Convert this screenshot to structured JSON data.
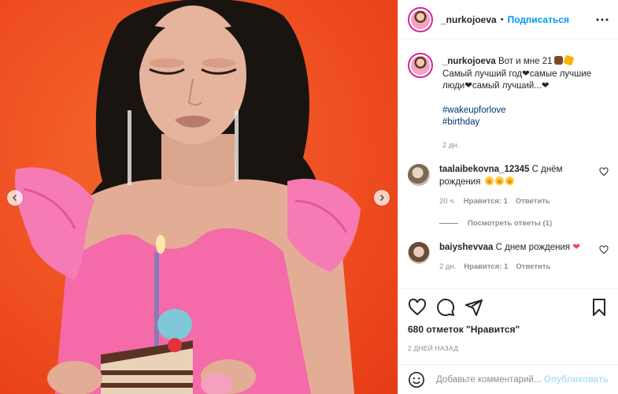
{
  "post": {
    "author": "_nurkojoeva",
    "dot": "•",
    "follow_label": "Подписаться",
    "caption": {
      "username": "_nurkojoeva",
      "line1": "Вот и мне 21",
      "line2": "Самый лучший год",
      "line2b": "самые лучшие",
      "line3": "люди",
      "line3b": "самый лучший...",
      "hashtags": [
        "#wakeupforlove",
        "#birthday"
      ],
      "time": "2 дн."
    },
    "comments": [
      {
        "username": "taalaibekovna_12345",
        "text": "С днём рождения",
        "time": "20 ч.",
        "likes": "Нравится: 1",
        "reply_label": "Ответить",
        "view_replies": "Посмотреть ответы (1)"
      },
      {
        "username": "baiyshevvaa",
        "text": "С днем рождения",
        "time": "2 дн.",
        "likes": "Нравится: 1",
        "reply_label": "Ответить"
      }
    ],
    "likes_label": "680 отметок \"Нравится\"",
    "date_label": "2 ДНЕЙ НАЗАД",
    "add_comment_placeholder": "Добавьте комментарий...",
    "publish_label": "Опубликовать"
  },
  "colors": {
    "link_blue": "#0095f6",
    "hashtag": "#00376b",
    "background_orange": "#ef4f21",
    "dress_pink": "#f56aa8"
  },
  "icons": [
    "chevron-left-icon",
    "chevron-right-icon",
    "more-icon",
    "heart-icon",
    "comment-icon",
    "share-icon",
    "bookmark-icon",
    "smiley-icon"
  ]
}
